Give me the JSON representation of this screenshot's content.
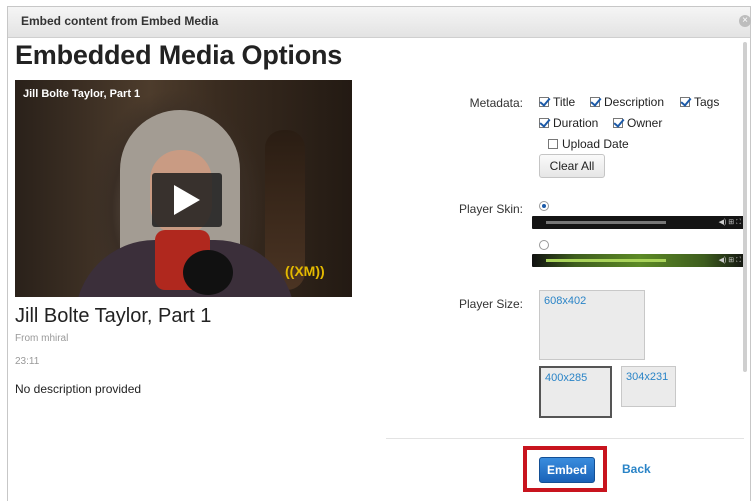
{
  "dialog": {
    "title": "Embed content from Embed Media",
    "close_glyph": "×"
  },
  "page_title": "Embedded Media Options",
  "video": {
    "overlay_title": "Jill Bolte Taylor, Part 1",
    "logo_text": "((XM))",
    "name": "Jill Bolte Taylor, Part 1",
    "from": "From mhiral",
    "duration": "23:11",
    "description": "No description provided"
  },
  "metadata": {
    "label": "Metadata:",
    "options": [
      {
        "label": "Title",
        "checked": true
      },
      {
        "label": "Description",
        "checked": true
      },
      {
        "label": "Tags",
        "checked": true
      },
      {
        "label": "Duration",
        "checked": true
      },
      {
        "label": "Owner",
        "checked": true
      },
      {
        "label": "Upload Date",
        "checked": false
      }
    ],
    "clear_all": "Clear All"
  },
  "player_skin": {
    "label": "Player Skin:",
    "selected": 0,
    "skins": [
      {
        "name": "dark-skin",
        "color": "#141414"
      },
      {
        "name": "green-skin",
        "color": "#5c8a26"
      }
    ]
  },
  "player_size": {
    "label": "Player Size:",
    "sizes": [
      {
        "label": "608x402",
        "selected": false
      },
      {
        "label": "400x285",
        "selected": true
      },
      {
        "label": "304x231",
        "selected": false
      }
    ]
  },
  "footer": {
    "embed": "Embed",
    "back": "Back"
  },
  "colors": {
    "accent": "#1a62b8",
    "link": "#2a84c7",
    "highlight": "#c8141e"
  }
}
